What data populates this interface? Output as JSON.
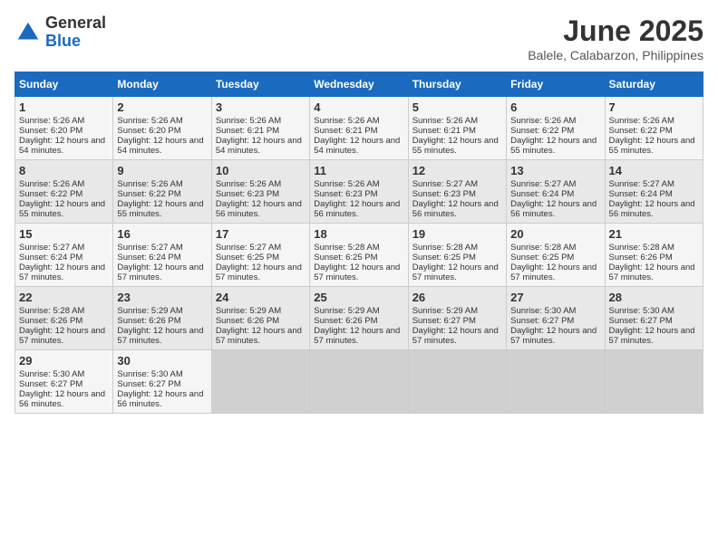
{
  "header": {
    "logo_general": "General",
    "logo_blue": "Blue",
    "month_year": "June 2025",
    "location": "Balele, Calabarzon, Philippines"
  },
  "calendar": {
    "days_of_week": [
      "Sunday",
      "Monday",
      "Tuesday",
      "Wednesday",
      "Thursday",
      "Friday",
      "Saturday"
    ],
    "weeks": [
      [
        null,
        null,
        null,
        null,
        null,
        null,
        null
      ]
    ],
    "cells": [
      {
        "day": null,
        "rise": null,
        "set": null,
        "daylight": null
      },
      {
        "day": null,
        "rise": null,
        "set": null,
        "daylight": null
      },
      {
        "day": null,
        "rise": null,
        "set": null,
        "daylight": null
      },
      {
        "day": null,
        "rise": null,
        "set": null,
        "daylight": null
      },
      {
        "day": null,
        "rise": null,
        "set": null,
        "daylight": null
      },
      {
        "day": null,
        "rise": null,
        "set": null,
        "daylight": null
      },
      {
        "day": null,
        "rise": null,
        "set": null,
        "daylight": null
      }
    ]
  },
  "weeks": [
    [
      {
        "day": "1",
        "rise": "Sunrise: 5:26 AM",
        "set": "Sunset: 6:20 PM",
        "daylight": "Daylight: 12 hours and 54 minutes."
      },
      {
        "day": "2",
        "rise": "Sunrise: 5:26 AM",
        "set": "Sunset: 6:20 PM",
        "daylight": "Daylight: 12 hours and 54 minutes."
      },
      {
        "day": "3",
        "rise": "Sunrise: 5:26 AM",
        "set": "Sunset: 6:21 PM",
        "daylight": "Daylight: 12 hours and 54 minutes."
      },
      {
        "day": "4",
        "rise": "Sunrise: 5:26 AM",
        "set": "Sunset: 6:21 PM",
        "daylight": "Daylight: 12 hours and 54 minutes."
      },
      {
        "day": "5",
        "rise": "Sunrise: 5:26 AM",
        "set": "Sunset: 6:21 PM",
        "daylight": "Daylight: 12 hours and 55 minutes."
      },
      {
        "day": "6",
        "rise": "Sunrise: 5:26 AM",
        "set": "Sunset: 6:22 PM",
        "daylight": "Daylight: 12 hours and 55 minutes."
      },
      {
        "day": "7",
        "rise": "Sunrise: 5:26 AM",
        "set": "Sunset: 6:22 PM",
        "daylight": "Daylight: 12 hours and 55 minutes."
      }
    ],
    [
      {
        "day": "8",
        "rise": "Sunrise: 5:26 AM",
        "set": "Sunset: 6:22 PM",
        "daylight": "Daylight: 12 hours and 55 minutes."
      },
      {
        "day": "9",
        "rise": "Sunrise: 5:26 AM",
        "set": "Sunset: 6:22 PM",
        "daylight": "Daylight: 12 hours and 55 minutes."
      },
      {
        "day": "10",
        "rise": "Sunrise: 5:26 AM",
        "set": "Sunset: 6:23 PM",
        "daylight": "Daylight: 12 hours and 56 minutes."
      },
      {
        "day": "11",
        "rise": "Sunrise: 5:26 AM",
        "set": "Sunset: 6:23 PM",
        "daylight": "Daylight: 12 hours and 56 minutes."
      },
      {
        "day": "12",
        "rise": "Sunrise: 5:27 AM",
        "set": "Sunset: 6:23 PM",
        "daylight": "Daylight: 12 hours and 56 minutes."
      },
      {
        "day": "13",
        "rise": "Sunrise: 5:27 AM",
        "set": "Sunset: 6:24 PM",
        "daylight": "Daylight: 12 hours and 56 minutes."
      },
      {
        "day": "14",
        "rise": "Sunrise: 5:27 AM",
        "set": "Sunset: 6:24 PM",
        "daylight": "Daylight: 12 hours and 56 minutes."
      }
    ],
    [
      {
        "day": "15",
        "rise": "Sunrise: 5:27 AM",
        "set": "Sunset: 6:24 PM",
        "daylight": "Daylight: 12 hours and 57 minutes."
      },
      {
        "day": "16",
        "rise": "Sunrise: 5:27 AM",
        "set": "Sunset: 6:24 PM",
        "daylight": "Daylight: 12 hours and 57 minutes."
      },
      {
        "day": "17",
        "rise": "Sunrise: 5:27 AM",
        "set": "Sunset: 6:25 PM",
        "daylight": "Daylight: 12 hours and 57 minutes."
      },
      {
        "day": "18",
        "rise": "Sunrise: 5:28 AM",
        "set": "Sunset: 6:25 PM",
        "daylight": "Daylight: 12 hours and 57 minutes."
      },
      {
        "day": "19",
        "rise": "Sunrise: 5:28 AM",
        "set": "Sunset: 6:25 PM",
        "daylight": "Daylight: 12 hours and 57 minutes."
      },
      {
        "day": "20",
        "rise": "Sunrise: 5:28 AM",
        "set": "Sunset: 6:25 PM",
        "daylight": "Daylight: 12 hours and 57 minutes."
      },
      {
        "day": "21",
        "rise": "Sunrise: 5:28 AM",
        "set": "Sunset: 6:26 PM",
        "daylight": "Daylight: 12 hours and 57 minutes."
      }
    ],
    [
      {
        "day": "22",
        "rise": "Sunrise: 5:28 AM",
        "set": "Sunset: 6:26 PM",
        "daylight": "Daylight: 12 hours and 57 minutes."
      },
      {
        "day": "23",
        "rise": "Sunrise: 5:29 AM",
        "set": "Sunset: 6:26 PM",
        "daylight": "Daylight: 12 hours and 57 minutes."
      },
      {
        "day": "24",
        "rise": "Sunrise: 5:29 AM",
        "set": "Sunset: 6:26 PM",
        "daylight": "Daylight: 12 hours and 57 minutes."
      },
      {
        "day": "25",
        "rise": "Sunrise: 5:29 AM",
        "set": "Sunset: 6:26 PM",
        "daylight": "Daylight: 12 hours and 57 minutes."
      },
      {
        "day": "26",
        "rise": "Sunrise: 5:29 AM",
        "set": "Sunset: 6:27 PM",
        "daylight": "Daylight: 12 hours and 57 minutes."
      },
      {
        "day": "27",
        "rise": "Sunrise: 5:30 AM",
        "set": "Sunset: 6:27 PM",
        "daylight": "Daylight: 12 hours and 57 minutes."
      },
      {
        "day": "28",
        "rise": "Sunrise: 5:30 AM",
        "set": "Sunset: 6:27 PM",
        "daylight": "Daylight: 12 hours and 57 minutes."
      }
    ],
    [
      {
        "day": "29",
        "rise": "Sunrise: 5:30 AM",
        "set": "Sunset: 6:27 PM",
        "daylight": "Daylight: 12 hours and 56 minutes."
      },
      {
        "day": "30",
        "rise": "Sunrise: 5:30 AM",
        "set": "Sunset: 6:27 PM",
        "daylight": "Daylight: 12 hours and 56 minutes."
      },
      null,
      null,
      null,
      null,
      null
    ]
  ],
  "colors": {
    "header_bg": "#1a6bbf",
    "odd_row": "#f5f5f5",
    "even_row": "#e8e8e8",
    "empty_cell": "#d0d0d0"
  }
}
